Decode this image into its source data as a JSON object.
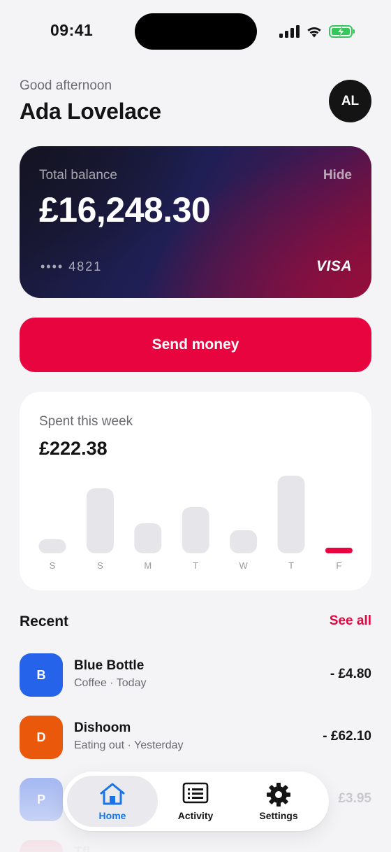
{
  "status_bar": {
    "time": "09:41"
  },
  "header": {
    "greeting": "Good afternoon",
    "name": "Ada Lovelace",
    "avatar_initials": "AL"
  },
  "balance_card": {
    "label": "Total balance",
    "hide_label": "Hide",
    "amount": "£16,248.30",
    "card_number": "•••• 4821",
    "brand": "VISA"
  },
  "send_button": {
    "label": "Send money"
  },
  "spending": {
    "label": "Spent this week",
    "amount": "£222.38",
    "accent_color": "#e8053f",
    "bar_color": "#e6e6ea"
  },
  "chart_data": {
    "type": "bar",
    "categories": [
      "S",
      "S",
      "M",
      "T",
      "W",
      "T",
      "F"
    ],
    "values": [
      20,
      93,
      43,
      66,
      33,
      111,
      8
    ],
    "highlight_index": 6
  },
  "recent": {
    "title": "Recent",
    "see_all": "See all",
    "transactions": [
      {
        "initial": "B",
        "name": "Blue Bottle",
        "meta": "Coffee · Today",
        "amount": "- £4.80",
        "color": "#2563eb"
      },
      {
        "initial": "D",
        "name": "Dishoom",
        "meta": "Eating out · Yesterday",
        "amount": "- £62.10",
        "color": "#ea580c"
      },
      {
        "initial": "P",
        "name": "",
        "meta": "",
        "amount": "£3.95",
        "color": "#6f8ff0"
      },
      {
        "initial": "",
        "name": "Tfl",
        "meta": "",
        "amount": "",
        "color": "#f2a2b4"
      }
    ]
  },
  "tab_bar": {
    "active_color": "#1a73e8",
    "tabs": [
      {
        "label": "Home",
        "icon": "home-icon",
        "active": true
      },
      {
        "label": "Activity",
        "icon": "activity-icon",
        "active": false
      },
      {
        "label": "Settings",
        "icon": "gear-icon",
        "active": false
      }
    ]
  }
}
